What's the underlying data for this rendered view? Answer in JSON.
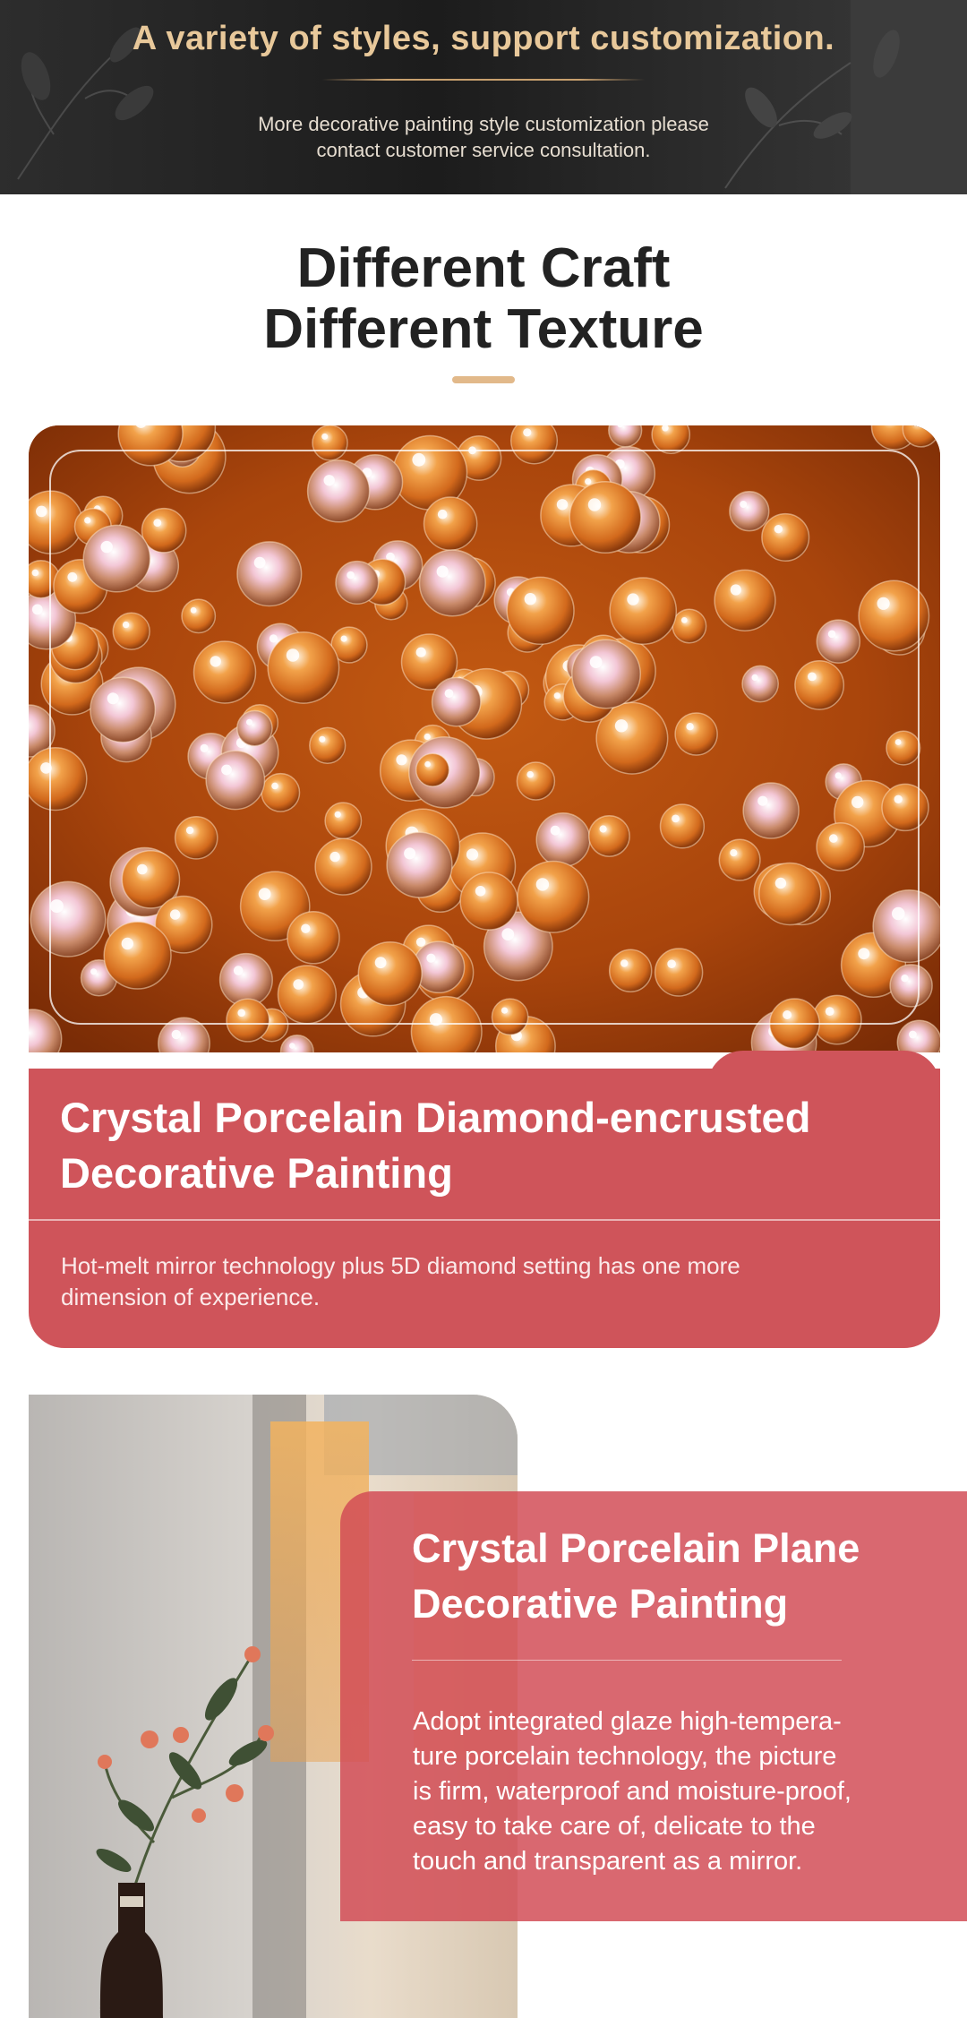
{
  "banner": {
    "title": "A variety of styles, support customization.",
    "subtitle_line1": "More decorative painting style customization please",
    "subtitle_line2": "contact customer service consultation."
  },
  "headline": {
    "line1": "Different Craft",
    "line2": "Different Texture"
  },
  "card1": {
    "title_line1": "Crystal Porcelain Diamond-encrusted",
    "title_line2": "Decorative Painting",
    "desc_line1": "Hot-melt mirror technology plus 5D diamond setting has one more",
    "desc_line2": "dimension of experience."
  },
  "card2": {
    "title_line1": "Crystal Porcelain Plane",
    "title_line2": "Decorative Painting",
    "desc_line1": "Adopt integrated glaze high-tempera-",
    "desc_line2": "ture porcelain technology, the picture",
    "desc_line3": "is firm, waterproof and moisture-proof,",
    "desc_line4": "easy to take care of, delicate to the",
    "desc_line5": "touch and transparent as a mirror."
  },
  "colors": {
    "banner_bg": "#222222",
    "banner_title": "#e8c89a",
    "accent_bar": "#e2b98a",
    "card_red": "#cf545a",
    "headline_text": "#222222"
  }
}
